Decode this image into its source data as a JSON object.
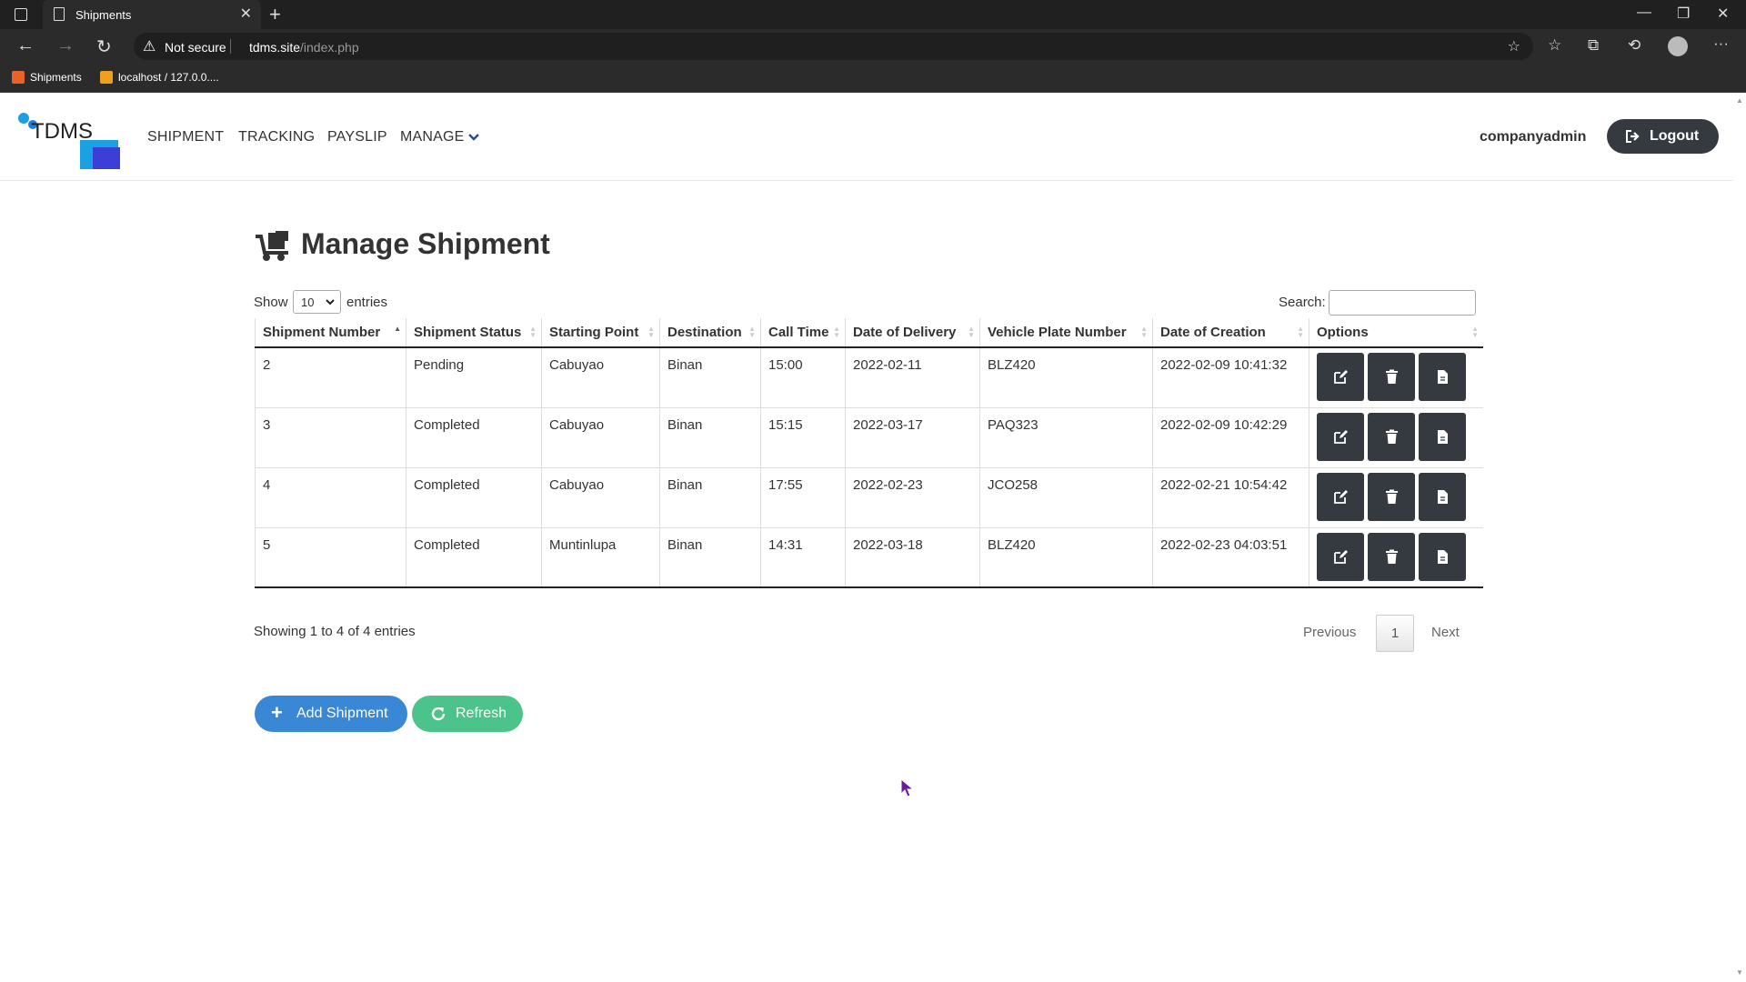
{
  "browser": {
    "tab_title": "Shipments",
    "address_warning": "Not secure",
    "url_host": "tdms.site",
    "url_path": "/index.php",
    "bookmarks": [
      {
        "label": "Shipments"
      },
      {
        "label": "localhost / 127.0.0...."
      }
    ]
  },
  "header": {
    "logo_text": "TDMS",
    "nav": {
      "shipment": "SHIPMENT",
      "tracking": "TRACKING",
      "payslip": "PAYSLIP",
      "manage": "MANAGE"
    },
    "username": "companyadmin",
    "logout_label": "Logout"
  },
  "main": {
    "title": "Manage Shipment",
    "show_label": "Show",
    "entries_value": "10",
    "entries_label": "entries",
    "search_label": "Search:",
    "search_value": "",
    "columns": [
      "Shipment Number",
      "Shipment Status",
      "Starting Point",
      "Destination",
      "Call Time",
      "Date of Delivery",
      "Vehicle Plate Number",
      "Date of Creation",
      "Options"
    ],
    "rows": [
      [
        "2",
        "Pending",
        "Cabuyao",
        "Binan",
        "15:00",
        "2022-02-11",
        "BLZ420",
        "2022-02-09 10:41:32"
      ],
      [
        "3",
        "Completed",
        "Cabuyao",
        "Binan",
        "15:15",
        "2022-03-17",
        "PAQ323",
        "2022-02-09 10:42:29"
      ],
      [
        "4",
        "Completed",
        "Cabuyao",
        "Binan",
        "17:55",
        "2022-02-23",
        "JCO258",
        "2022-02-21 10:54:42"
      ],
      [
        "5",
        "Completed",
        "Muntinlupa",
        "Binan",
        "14:31",
        "2022-03-18",
        "BLZ420",
        "2022-02-23 04:03:51"
      ]
    ],
    "info_text": "Showing 1 to 4 of 4 entries",
    "pager": {
      "previous": "Previous",
      "current": "1",
      "next": "Next"
    },
    "add_button": "Add Shipment",
    "refresh_button": "Refresh"
  },
  "colors": {
    "dark_button": "#343a40",
    "add_button": "#3a87d6",
    "refresh_button": "#4cc38a",
    "logo_cyan": "#1ba1e2",
    "logo_blue": "#3b3fd8"
  }
}
